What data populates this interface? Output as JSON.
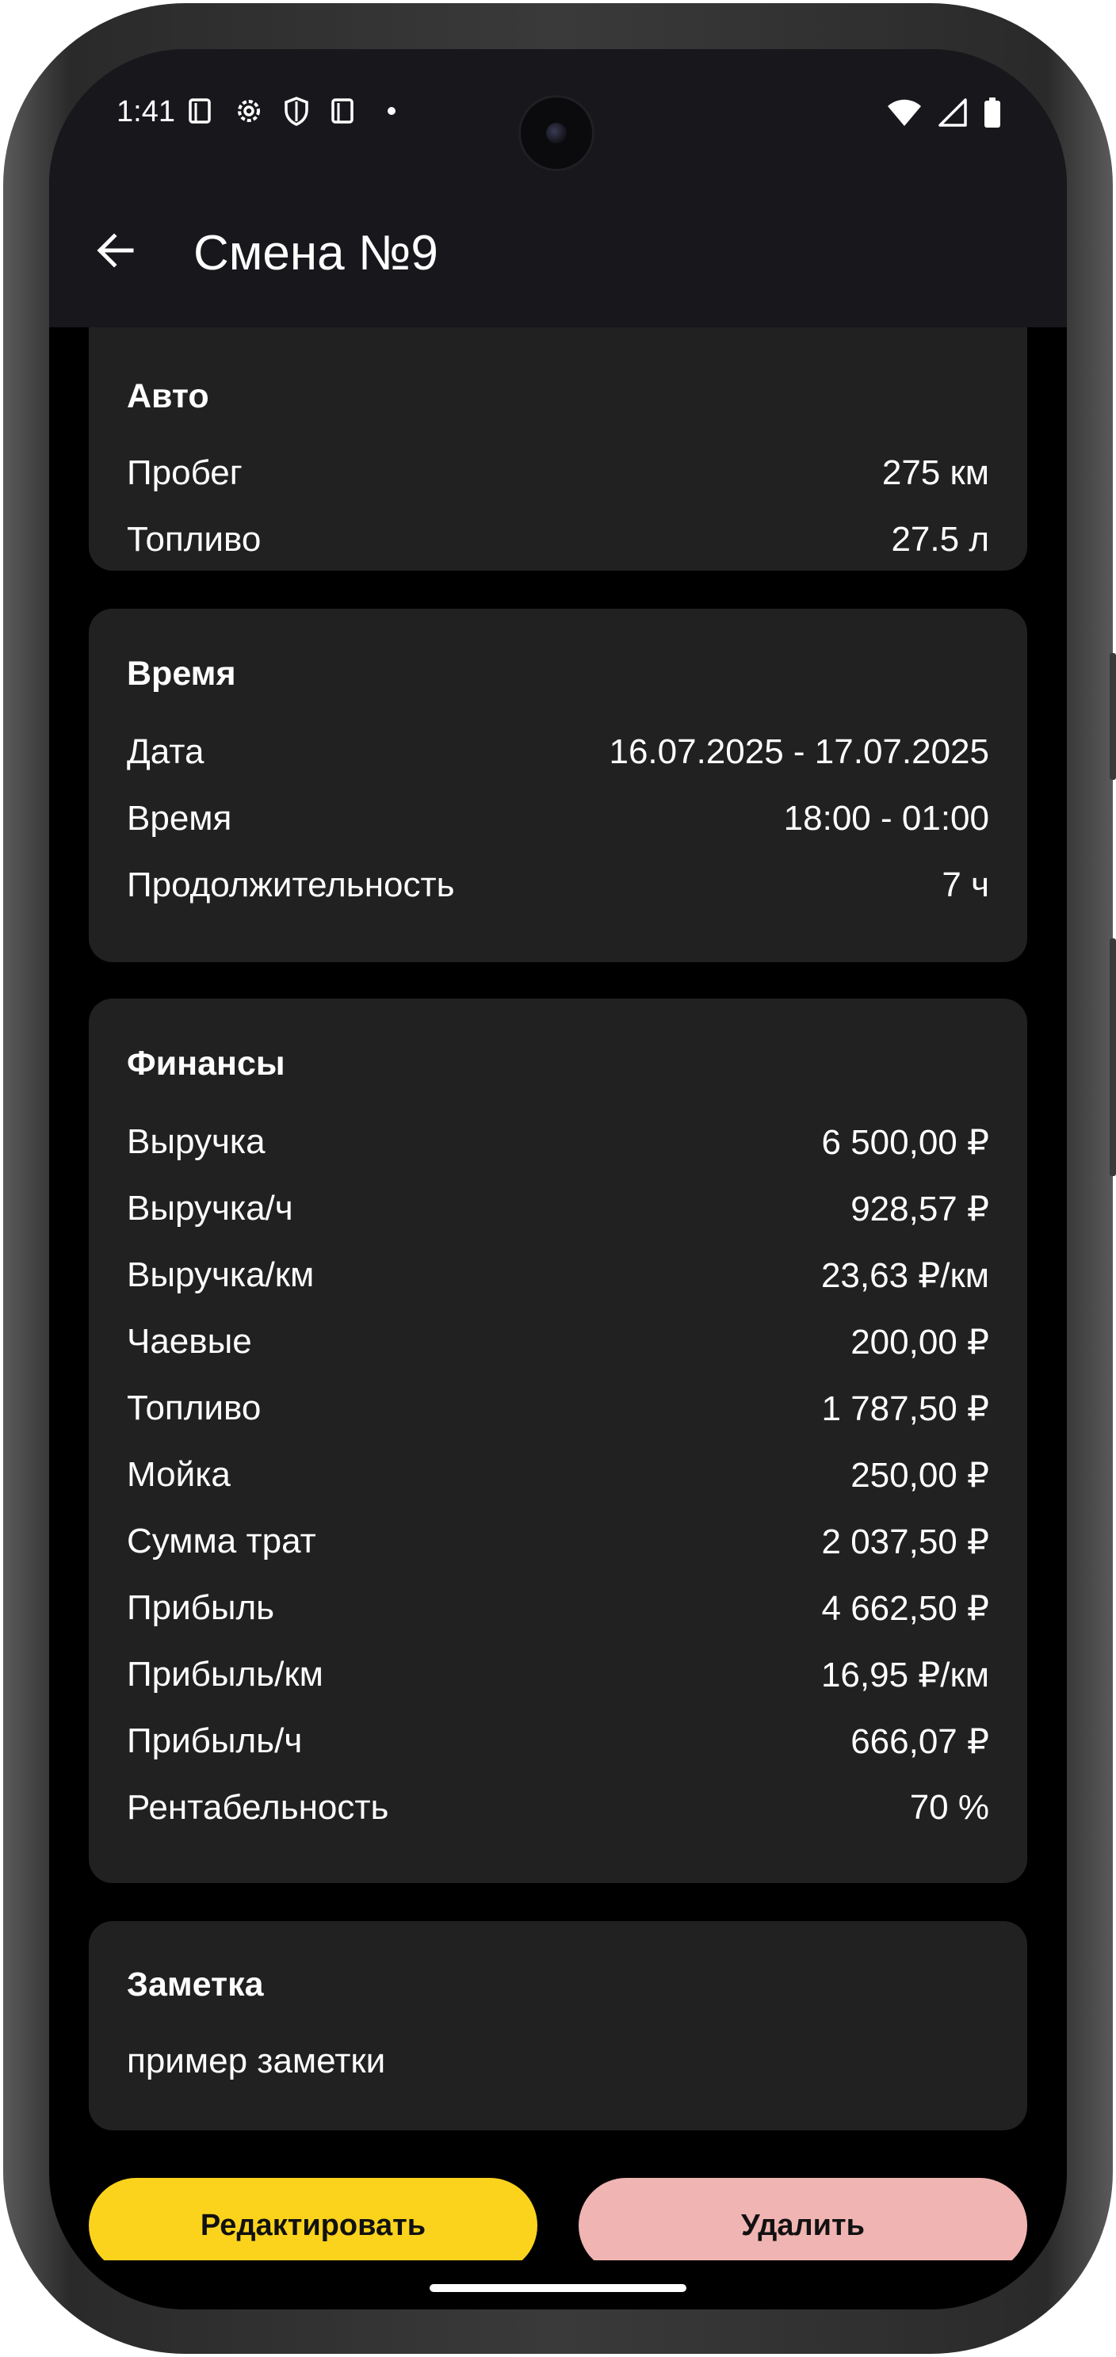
{
  "status_bar": {
    "time": "1:41"
  },
  "app_bar": {
    "title": "Смена №9"
  },
  "auto": {
    "title": "Авто",
    "rows": [
      {
        "label": "Пробег",
        "value": "275 км"
      },
      {
        "label": "Топливо",
        "value": "27.5 л"
      }
    ]
  },
  "time_section": {
    "title": "Время",
    "rows": [
      {
        "label": "Дата",
        "value": "16.07.2025 - 17.07.2025"
      },
      {
        "label": "Время",
        "value": "18:00 - 01:00"
      },
      {
        "label": "Продолжительность",
        "value": "7 ч"
      }
    ]
  },
  "finance": {
    "title": "Финансы",
    "rows": [
      {
        "label": "Выручка",
        "value": "6 500,00 ₽"
      },
      {
        "label": "Выручка/ч",
        "value": "928,57 ₽"
      },
      {
        "label": "Выручка/км",
        "value": "23,63 ₽/км"
      },
      {
        "label": "Чаевые",
        "value": "200,00 ₽"
      },
      {
        "label": "Топливо",
        "value": "1 787,50 ₽"
      },
      {
        "label": "Мойка",
        "value": "250,00 ₽"
      },
      {
        "label": "Сумма трат",
        "value": "2 037,50 ₽"
      },
      {
        "label": "Прибыль",
        "value": "4 662,50 ₽"
      },
      {
        "label": "Прибыль/км",
        "value": "16,95 ₽/км"
      },
      {
        "label": "Прибыль/ч",
        "value": "666,07 ₽"
      },
      {
        "label": "Рентабельность",
        "value": "70 %"
      }
    ]
  },
  "note": {
    "title": "Заметка",
    "text": "пример заметки"
  },
  "actions": {
    "edit_label": "Редактировать",
    "delete_label": "Удалить"
  },
  "colors": {
    "background": "#000000",
    "card": "#212121",
    "app_bar": "#18171c",
    "edit_button": "#fbd31d",
    "delete_button": "#f0b4b2"
  },
  "icons": {
    "back": "arrow-back-icon",
    "status_left": [
      "screenshot-icon",
      "settings-icon",
      "shield-icon",
      "screenshot-icon",
      "dot-icon"
    ],
    "status_right": [
      "wifi-icon",
      "signal-icon",
      "battery-icon"
    ]
  }
}
